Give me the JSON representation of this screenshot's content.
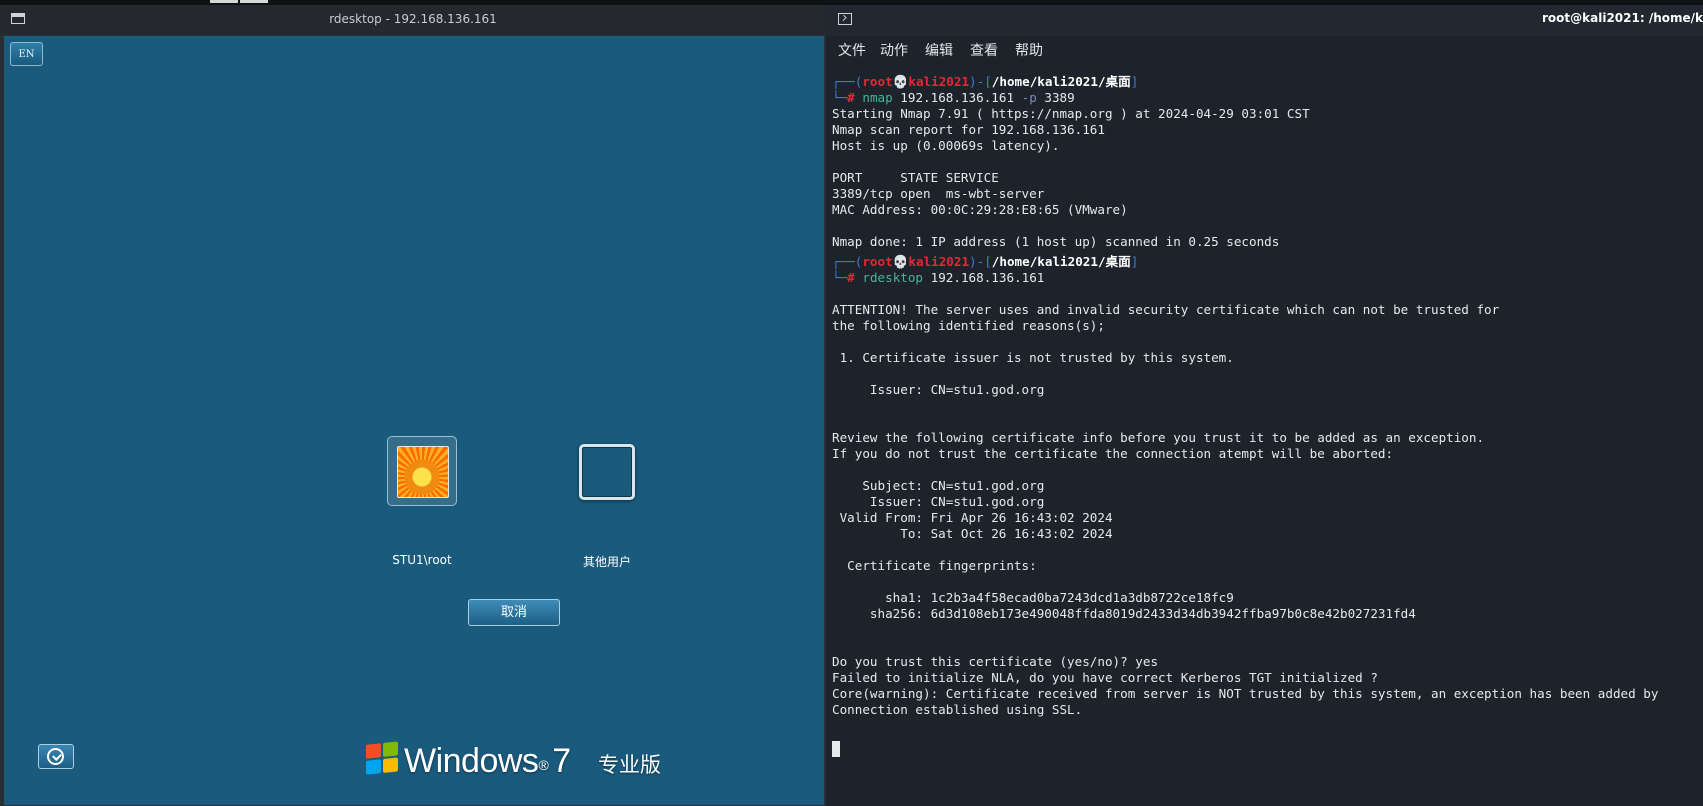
{
  "rdesktop": {
    "title": "rdesktop - 192.168.136.161",
    "login": {
      "lang_indicator": "EN",
      "users": [
        "STU1\\root",
        "其他用户"
      ],
      "cancel_label": "取消",
      "brand": "Windows",
      "brand_version": "7",
      "edition": "专业版"
    }
  },
  "terminal": {
    "title": "root@kali2021: /home/k",
    "menu": [
      "文件",
      "动作",
      "编辑",
      "查看",
      "帮助"
    ],
    "prompt": {
      "user": "root",
      "skull": "💀",
      "host": "kali2021",
      "path": "/home/kali2021/桌面"
    },
    "cmd1": {
      "name": "nmap",
      "arg": "192.168.136.161",
      "flag": "-p",
      "port": "3389"
    },
    "cmd2": {
      "name": "rdesktop",
      "arg": "192.168.136.161"
    },
    "out1": [
      "Starting Nmap 7.91 ( https://nmap.org ) at 2024-04-29 03:01 CST",
      "Nmap scan report for 192.168.136.161",
      "Host is up (0.00069s latency).",
      "",
      "PORT     STATE SERVICE",
      "3389/tcp open  ms-wbt-server",
      "MAC Address: 00:0C:29:28:E8:65 (VMware)",
      "",
      "Nmap done: 1 IP address (1 host up) scanned in 0.25 seconds"
    ],
    "out2": [
      "ATTENTION! The server uses and invalid security certificate which can not be trusted for",
      "the following identified reasons(s);",
      "",
      " 1. Certificate issuer is not trusted by this system.",
      "",
      "     Issuer: CN=stu1.god.org",
      "",
      "",
      "Review the following certificate info before you trust it to be added as an exception.",
      "If you do not trust the certificate the connection atempt will be aborted:",
      "",
      "    Subject: CN=stu1.god.org",
      "     Issuer: CN=stu1.god.org",
      " Valid From: Fri Apr 26 16:43:02 2024",
      "         To: Sat Oct 26 16:43:02 2024",
      "",
      "  Certificate fingerprints:",
      "",
      "       sha1: 1c2b3a4f58ecad0ba7243dcd1a3db8722ce18fc9",
      "     sha256: 6d3d108eb173e490048ffda8019d2433d34db3942ffba97b0c8e42b027231fd4",
      "",
      "",
      "Do you trust this certificate (yes/no)? yes",
      "Failed to initialize NLA, do you have correct Kerberos TGT initialized ?",
      "Core(warning): Certificate received from server is NOT trusted by this system, an exception has been added by",
      "Connection established using SSL."
    ]
  }
}
